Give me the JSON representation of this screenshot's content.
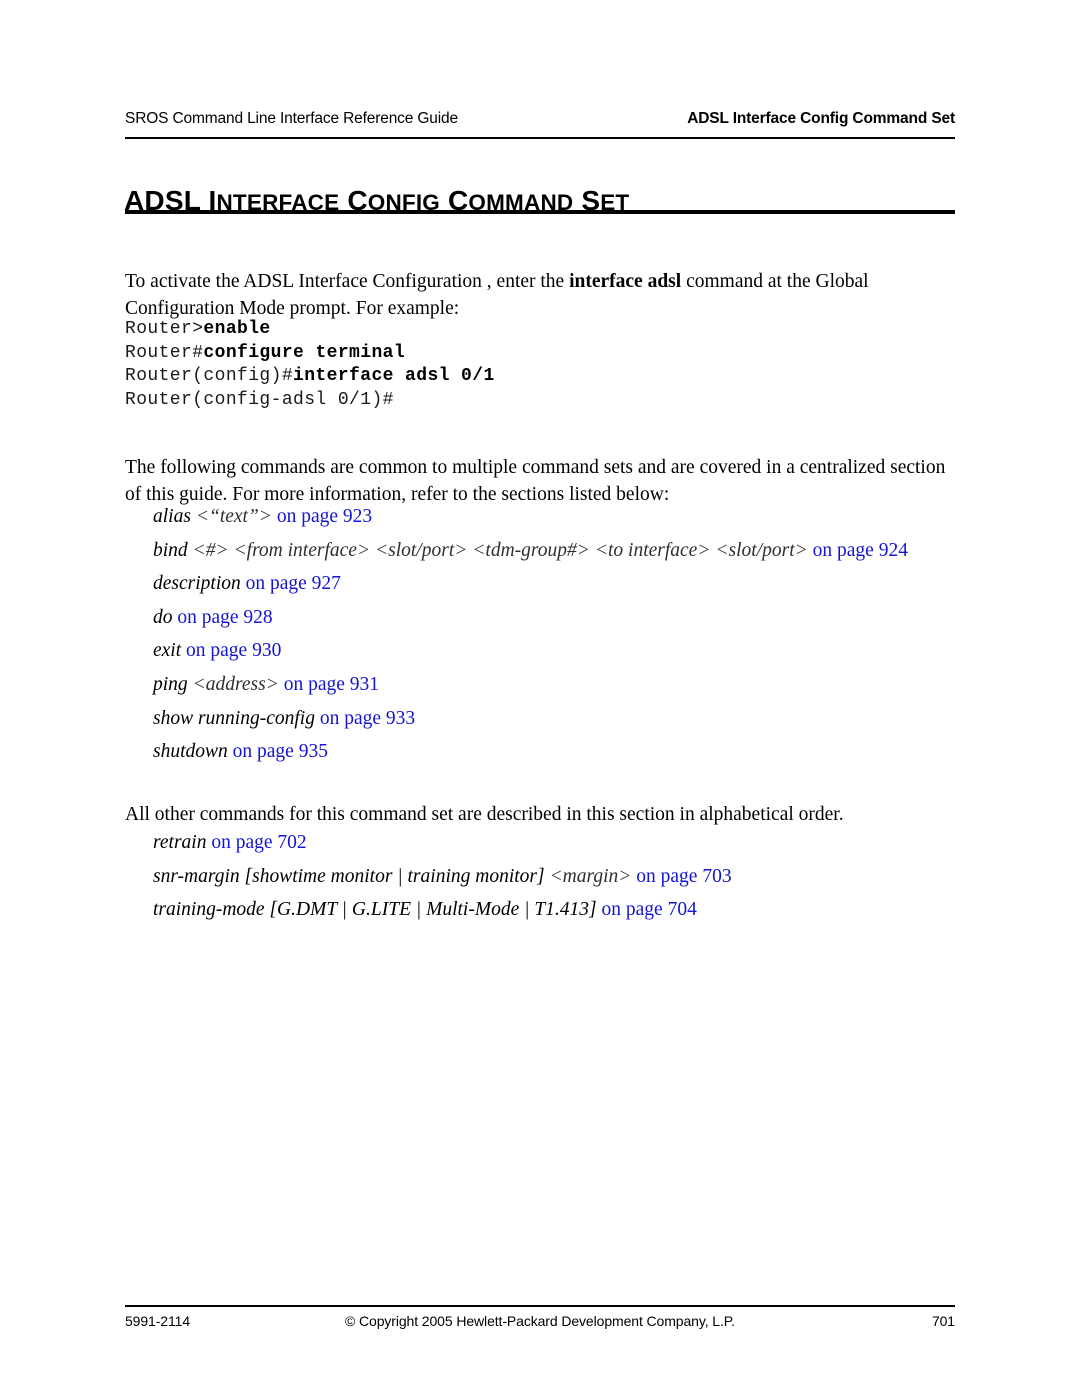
{
  "header": {
    "left": "SROS Command Line Interface Reference Guide",
    "right": "ADSL Interface Config Command Set"
  },
  "title": {
    "word1": "ADSL",
    "word2_cap": "I",
    "word2_rest": "NTERFACE",
    "word3_cap": "C",
    "word3_rest": "ONFIG",
    "word4_cap": "C",
    "word4_rest": "OMMAND",
    "word5_cap": "S",
    "word5_rest": "ET",
    "full_text": "ADSL Interface Config Command Set"
  },
  "paragraphs": {
    "intro_a": "To activate the ADSL Interface Configuration , enter the ",
    "intro_bold": "interface adsl",
    "intro_b": " command at the Global Configuration Mode prompt. For example:",
    "common": "The following commands are common to multiple command sets and are covered in a centralized section of this guide. For more information, refer to the sections listed below:",
    "other": "All other commands for this command set are described in this section in alphabetical order."
  },
  "code_block": {
    "lines": [
      {
        "prompt": "Router>",
        "command": "enable"
      },
      {
        "prompt": "Router#",
        "command": "configure terminal"
      },
      {
        "prompt": "Router(config)#",
        "command": "interface adsl 0/1"
      },
      {
        "prompt": "Router(config-adsl 0/1)#",
        "command": ""
      }
    ]
  },
  "xref_common": [
    {
      "name": "alias ",
      "param": "<“text”>",
      "tail": "",
      "pageref": " on page 923"
    },
    {
      "name": "bind ",
      "param": "<#> <from interface> <slot/port> <tdm-group#> <to interface> <slot/port>",
      "tail": "",
      "pageref": " on page 924"
    },
    {
      "name": "description",
      "param": "",
      "tail": "",
      "pageref": " on page 927"
    },
    {
      "name": "do",
      "param": "",
      "tail": "",
      "pageref": " on page 928"
    },
    {
      "name": "exit",
      "param": "",
      "tail": "",
      "pageref": " on page 930"
    },
    {
      "name": "ping ",
      "param": "<address>",
      "tail": "",
      "pageref": " on page 931"
    },
    {
      "name": "show running-config",
      "param": "",
      "tail": "",
      "pageref": " on page 933"
    },
    {
      "name": "shutdown",
      "param": "",
      "tail": "",
      "pageref": " on page 935"
    }
  ],
  "xref_other": [
    {
      "name": "retrain",
      "param": "",
      "tail": "",
      "pageref": " on page 702"
    },
    {
      "name": "snr-margin [showtime monitor | training monitor] ",
      "param": "<margin>",
      "tail": "",
      "pageref": " on page 703"
    },
    {
      "name": "training-mode [G.DMT | G.LITE | Multi-Mode | T1.413]",
      "param": "",
      "tail": "",
      "pageref": " on page 704"
    }
  ],
  "footer": {
    "left": "5991-2114",
    "center": "© Copyright 2005 Hewlett-Packard Development Company, L.P.",
    "right": "701"
  },
  "colors": {
    "link": "#1414d2",
    "text": "#000000",
    "param": "#2f2f2f"
  }
}
